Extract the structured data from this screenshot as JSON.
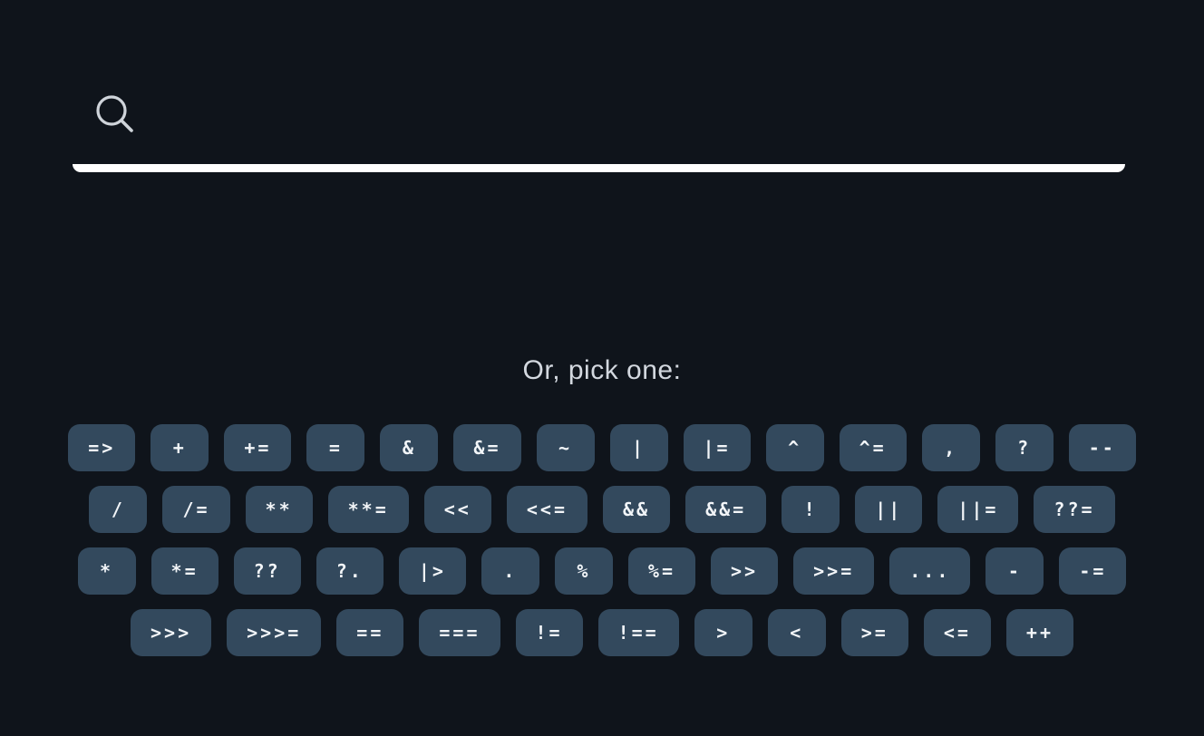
{
  "search": {
    "value": "",
    "placeholder": ""
  },
  "prompt": "Or, pick one:",
  "colors": {
    "background": "#0f141b",
    "key_background": "#33495d",
    "key_text": "#f2f5f8",
    "underline": "#ffffff",
    "prompt_text": "#d3d8df"
  },
  "icons": {
    "search": "search-icon"
  },
  "operator_rows": [
    [
      "=>",
      "+",
      "+=",
      "=",
      "&",
      "&=",
      "~",
      "|",
      "|=",
      "^",
      "^=",
      ",",
      "?",
      "--"
    ],
    [
      "/",
      "/=",
      "**",
      "**=",
      "<<",
      "<<=",
      "&&",
      "&&=",
      "!",
      "||",
      "||=",
      "??="
    ],
    [
      "*",
      "*=",
      "??",
      "?.",
      "|>",
      ".",
      "%",
      "%=",
      ">>",
      ">>=",
      "...",
      "-",
      "-="
    ],
    [
      ">>>",
      ">>>=",
      "==",
      "===",
      "!=",
      "!==",
      ">",
      "<",
      ">=",
      "<=",
      "++"
    ]
  ]
}
